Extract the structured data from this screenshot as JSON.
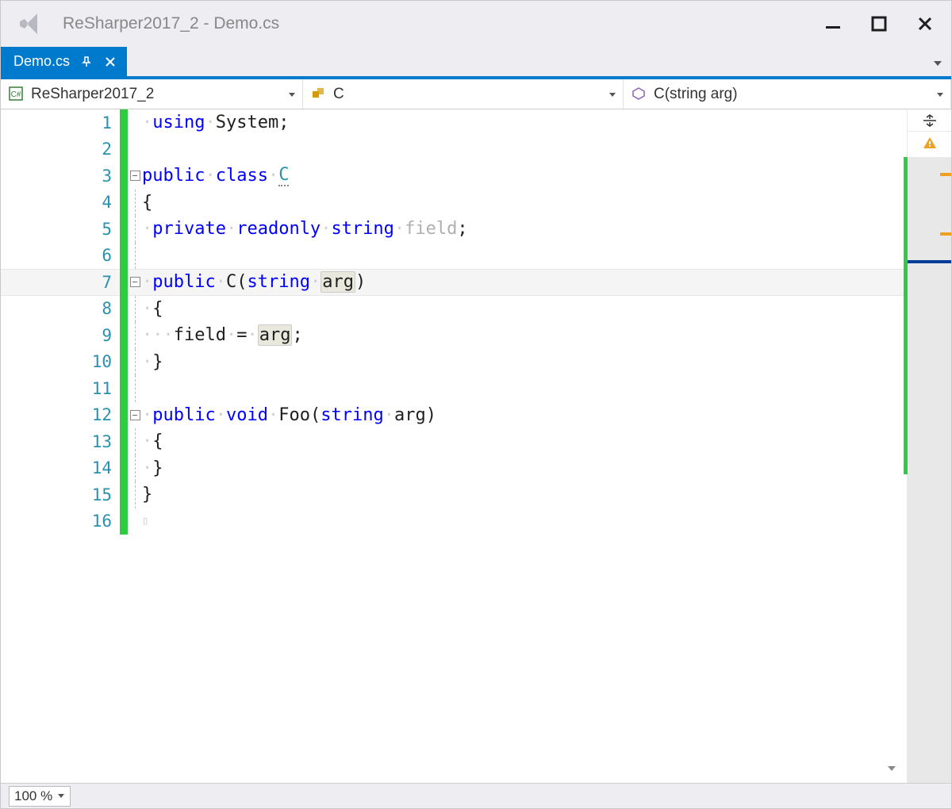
{
  "window": {
    "title_project": "ReSharper2017_2",
    "title_sep": " - ",
    "title_file": "Demo.cs"
  },
  "tab": {
    "label": "Demo.cs"
  },
  "nav": {
    "project": "ReSharper2017_2",
    "class": "C",
    "member": "C(string arg)"
  },
  "lines": {
    "1": "1",
    "2": "2",
    "3": "3",
    "4": "4",
    "5": "5",
    "6": "6",
    "7": "7",
    "8": "8",
    "9": "9",
    "10": "10",
    "11": "11",
    "12": "12",
    "13": "13",
    "14": "14",
    "15": "15",
    "16": "16"
  },
  "code": {
    "using": "using",
    "system": "System",
    "semi": ";",
    "public": "public",
    "class": "class",
    "C": "C",
    "lbrace": "{",
    "rbrace": "}",
    "private": "private",
    "readonly": "readonly",
    "string": "string",
    "field": "field",
    "void": "void",
    "Foo": "Foo",
    "lparen": "(",
    "rparen": ")",
    "arg": "arg",
    "eq": "=",
    "dot": "·"
  },
  "zoom": "100 %"
}
